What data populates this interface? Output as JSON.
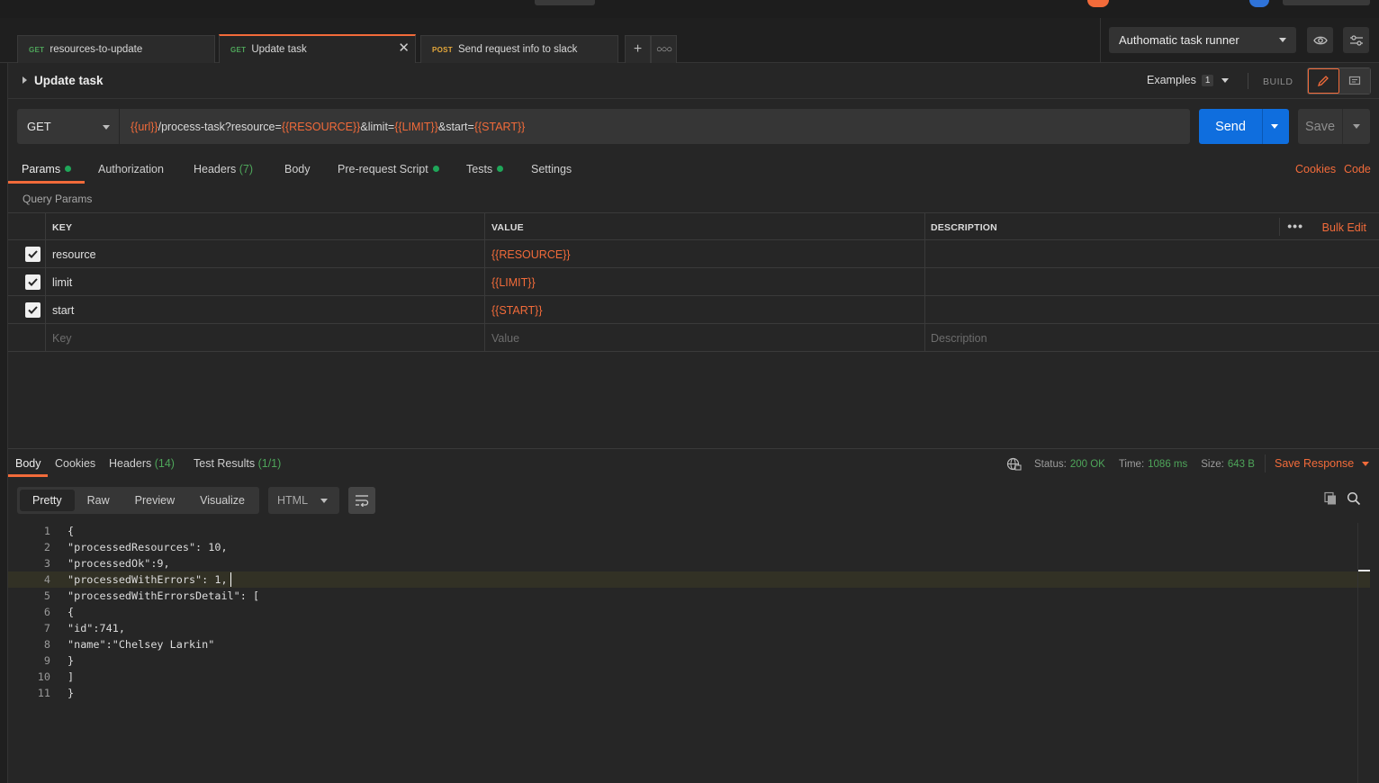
{
  "tabs": [
    {
      "method": "GET",
      "label": "resources-to-update"
    },
    {
      "method": "GET",
      "label": "Update task",
      "active": true
    },
    {
      "method": "POST",
      "label": "Send request info to slack"
    }
  ],
  "environment": {
    "selected": "Authomatic task runner"
  },
  "request": {
    "title": "Update task",
    "examples_label": "Examples",
    "examples_count": "1",
    "build_label": "BUILD",
    "method": "GET",
    "url_parts": [
      {
        "text": "{{url}}",
        "var": true
      },
      {
        "text": "/process-task?resource=",
        "var": false
      },
      {
        "text": "{{RESOURCE}}",
        "var": true
      },
      {
        "text": "&limit=",
        "var": false
      },
      {
        "text": "{{LIMIT}}",
        "var": true
      },
      {
        "text": "&start=",
        "var": false
      },
      {
        "text": "{{START}}",
        "var": true
      }
    ],
    "send_label": "Send",
    "save_label": "Save"
  },
  "request_tabs": {
    "params": "Params",
    "authorization": "Authorization",
    "headers": "Headers",
    "headers_count": "(7)",
    "body": "Body",
    "prerequest": "Pre-request Script",
    "tests": "Tests",
    "settings": "Settings",
    "cookies": "Cookies",
    "code": "Code"
  },
  "query_params": {
    "label": "Query Params",
    "columns": {
      "key": "KEY",
      "value": "VALUE",
      "description": "DESCRIPTION"
    },
    "bulk_edit": "Bulk Edit",
    "rows": [
      {
        "key": "resource",
        "value": "{{RESOURCE}}",
        "description": ""
      },
      {
        "key": "limit",
        "value": "{{LIMIT}}",
        "description": ""
      },
      {
        "key": "start",
        "value": "{{START}}",
        "description": ""
      }
    ],
    "placeholders": {
      "key": "Key",
      "value": "Value",
      "description": "Description"
    }
  },
  "response": {
    "tabs": {
      "body": "Body",
      "cookies": "Cookies",
      "headers": "Headers",
      "headers_count": "(14)",
      "test_results": "Test Results",
      "test_results_count": "(1/1)"
    },
    "status_label": "Status:",
    "status": "200 OK",
    "time_label": "Time:",
    "time": "1086 ms",
    "size_label": "Size:",
    "size": "643 B",
    "save_response": "Save Response",
    "views": [
      "Pretty",
      "Raw",
      "Preview",
      "Visualize"
    ],
    "format": "HTML",
    "code_lines": [
      "{",
      "\"processedResources\": 10,",
      "\"processedOk\":9,",
      "\"processedWithErrors\": 1,",
      "\"processedWithErrorsDetail\": [",
      "{",
      "\"id\":741,",
      "\"name\":\"Chelsey Larkin\"",
      "}",
      "]",
      "}"
    ],
    "highlighted_line": 4
  },
  "colors": {
    "accent": "#f26b3a",
    "send_blue": "#0f6ede",
    "green": "#4ea55a"
  }
}
